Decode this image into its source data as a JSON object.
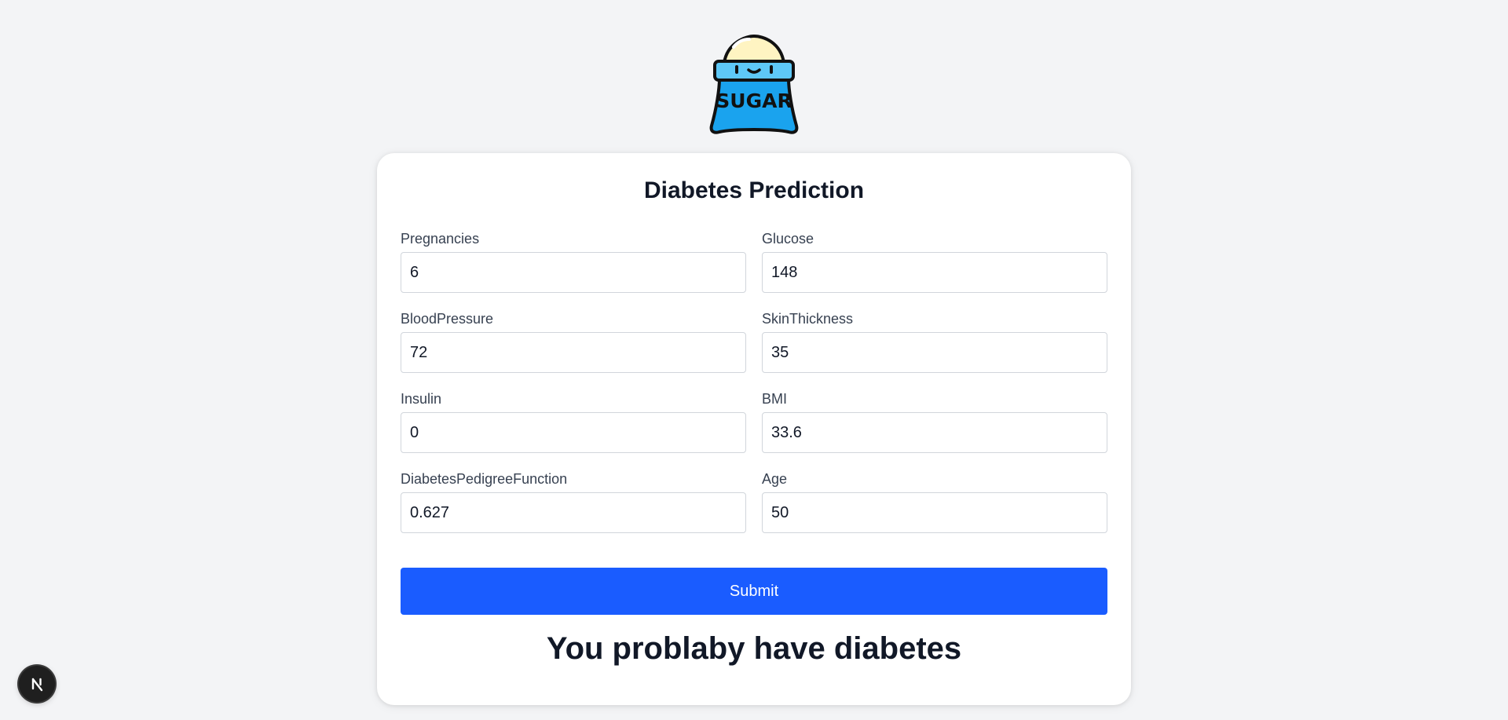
{
  "logo": {
    "text": "SUGAR",
    "icon": "sugar-bag-icon"
  },
  "form": {
    "title": "Diabetes Prediction",
    "fields": [
      {
        "label": "Pregnancies",
        "value": "6"
      },
      {
        "label": "Glucose",
        "value": "148"
      },
      {
        "label": "BloodPressure",
        "value": "72"
      },
      {
        "label": "SkinThickness",
        "value": "35"
      },
      {
        "label": "Insulin",
        "value": "0"
      },
      {
        "label": "BMI",
        "value": "33.6"
      },
      {
        "label": "DiabetesPedigreeFunction",
        "value": "0.627"
      },
      {
        "label": "Age",
        "value": "50"
      }
    ],
    "submit_label": "Submit",
    "result": "You problaby have diabetes"
  },
  "dev_badge": {
    "icon": "nextjs-icon"
  },
  "colors": {
    "background": "#f3f4f6",
    "card": "#ffffff",
    "accent": "#1a5cff",
    "bag": "#1aa3ee",
    "bag_top": "#fff4c2"
  }
}
